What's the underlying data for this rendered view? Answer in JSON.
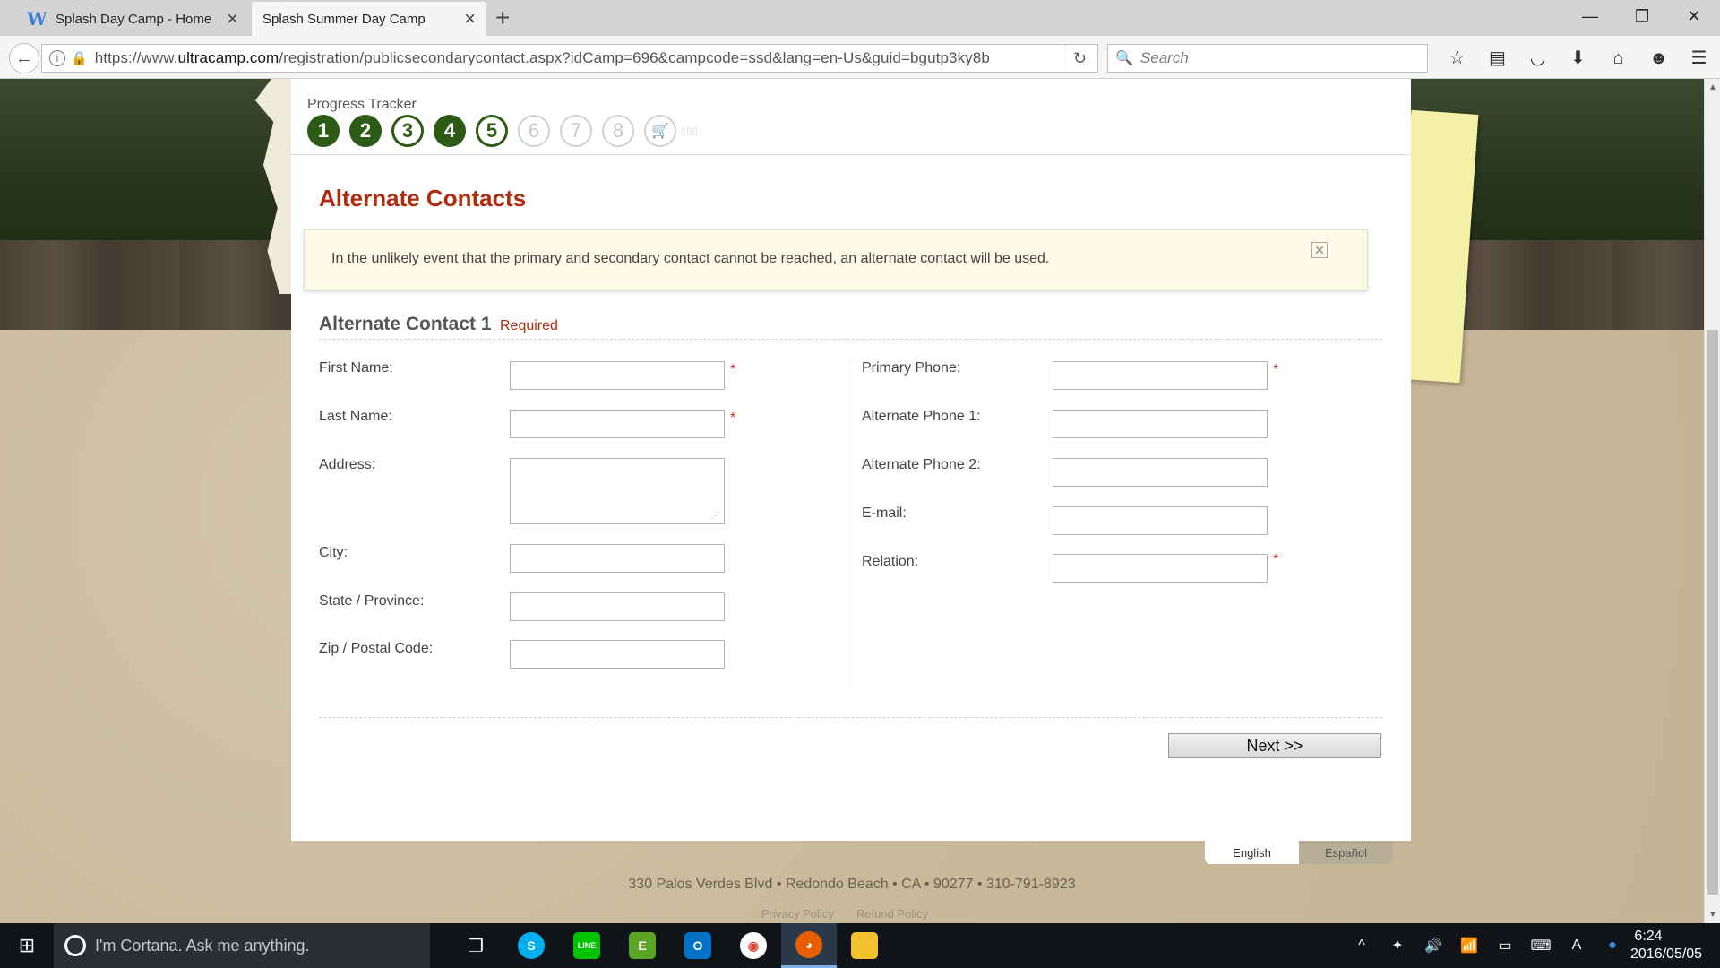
{
  "browser": {
    "tabs": [
      {
        "label": "Splash Day Camp - Home",
        "favicon": "W"
      },
      {
        "label": "Splash Summer Day Camp"
      }
    ],
    "url_prefix": "https://www.",
    "url_domain": "ultracamp.com",
    "url_path": "/registration/publicsecondarycontact.aspx?idCamp=696&campcode=ssd&lang=en-Us&guid=bgutp3ky8b",
    "search_placeholder": "Search",
    "icons": {
      "back": "←",
      "info": "i",
      "lock": "🔒",
      "reload": "↻",
      "search": "🔍",
      "close_tab": "×",
      "new_tab": "+",
      "minimize": "—",
      "restore": "❐",
      "close_window": "✕",
      "bookmark_star": "☆",
      "reading_list": "▤",
      "pocket": "◡",
      "downloads": "⬇",
      "home": "⌂",
      "smiley": "☻",
      "menu": "☰"
    }
  },
  "tracker": {
    "label": "Progress Tracker",
    "steps": [
      {
        "num": "1",
        "state": "done"
      },
      {
        "num": "2",
        "state": "done"
      },
      {
        "num": "3",
        "state": "current"
      },
      {
        "num": "4",
        "state": "done"
      },
      {
        "num": "5",
        "state": "current"
      },
      {
        "num": "6",
        "state": "future"
      },
      {
        "num": "7",
        "state": "future"
      },
      {
        "num": "8",
        "state": "future"
      }
    ],
    "cart_icon": "🛒"
  },
  "page": {
    "title": "Alternate Contacts",
    "notice": "In the unlikely event that the primary and secondary contact cannot be reached, an alternate contact will be used.",
    "notice_close": "✕",
    "section_title": "Alternate Contact 1",
    "section_required": "Required",
    "required_star": "*",
    "left_fields": [
      {
        "label": "First Name:",
        "value": ""
      },
      {
        "label": "Last Name:",
        "value": ""
      },
      {
        "label": "Address:",
        "value": ""
      },
      {
        "label": "City:",
        "value": ""
      },
      {
        "label": "State / Province:",
        "value": ""
      },
      {
        "label": "Zip / Postal Code:",
        "value": ""
      }
    ],
    "right_fields": [
      {
        "label": "Primary Phone:",
        "value": ""
      },
      {
        "label": "Alternate Phone 1:",
        "value": ""
      },
      {
        "label": "Alternate Phone 2:",
        "value": ""
      },
      {
        "label": "E-mail:",
        "value": ""
      },
      {
        "label": "Relation:",
        "value": ""
      }
    ],
    "next_label": "Next >>",
    "languages": [
      "English",
      "Español"
    ]
  },
  "footer": {
    "address": "330 Palos Verdes Blvd • Redondo Beach • CA • 90277 • 310-791-8923",
    "links": [
      "Privacy Policy",
      "Refund Policy"
    ]
  },
  "taskbar": {
    "cortana_text": "I'm Cortana. Ask me anything.",
    "apps": [
      {
        "name": "task-view",
        "glyph": "❐"
      },
      {
        "name": "skype",
        "glyph": "S",
        "color": "#00aff0"
      },
      {
        "name": "line",
        "glyph": "LINE",
        "color": "#00c300"
      },
      {
        "name": "evernote",
        "glyph": "E",
        "color": "#5ba525"
      },
      {
        "name": "outlook",
        "glyph": "O",
        "color": "#0072c6"
      },
      {
        "name": "chrome",
        "glyph": "◉",
        "color": "#db4437"
      },
      {
        "name": "firefox",
        "glyph": "◕",
        "color": "#e66000"
      },
      {
        "name": "file-explorer",
        "glyph": "▬",
        "color": "#f2c12e"
      }
    ],
    "tray": {
      "chevron": "^",
      "dropbox": "✦",
      "volume": "🔊",
      "wifi": "📶",
      "action_center": "▭",
      "keyboard": "⌨",
      "ime": "A"
    },
    "clock_time": "6:24",
    "clock_date": "2016/05/05"
  }
}
